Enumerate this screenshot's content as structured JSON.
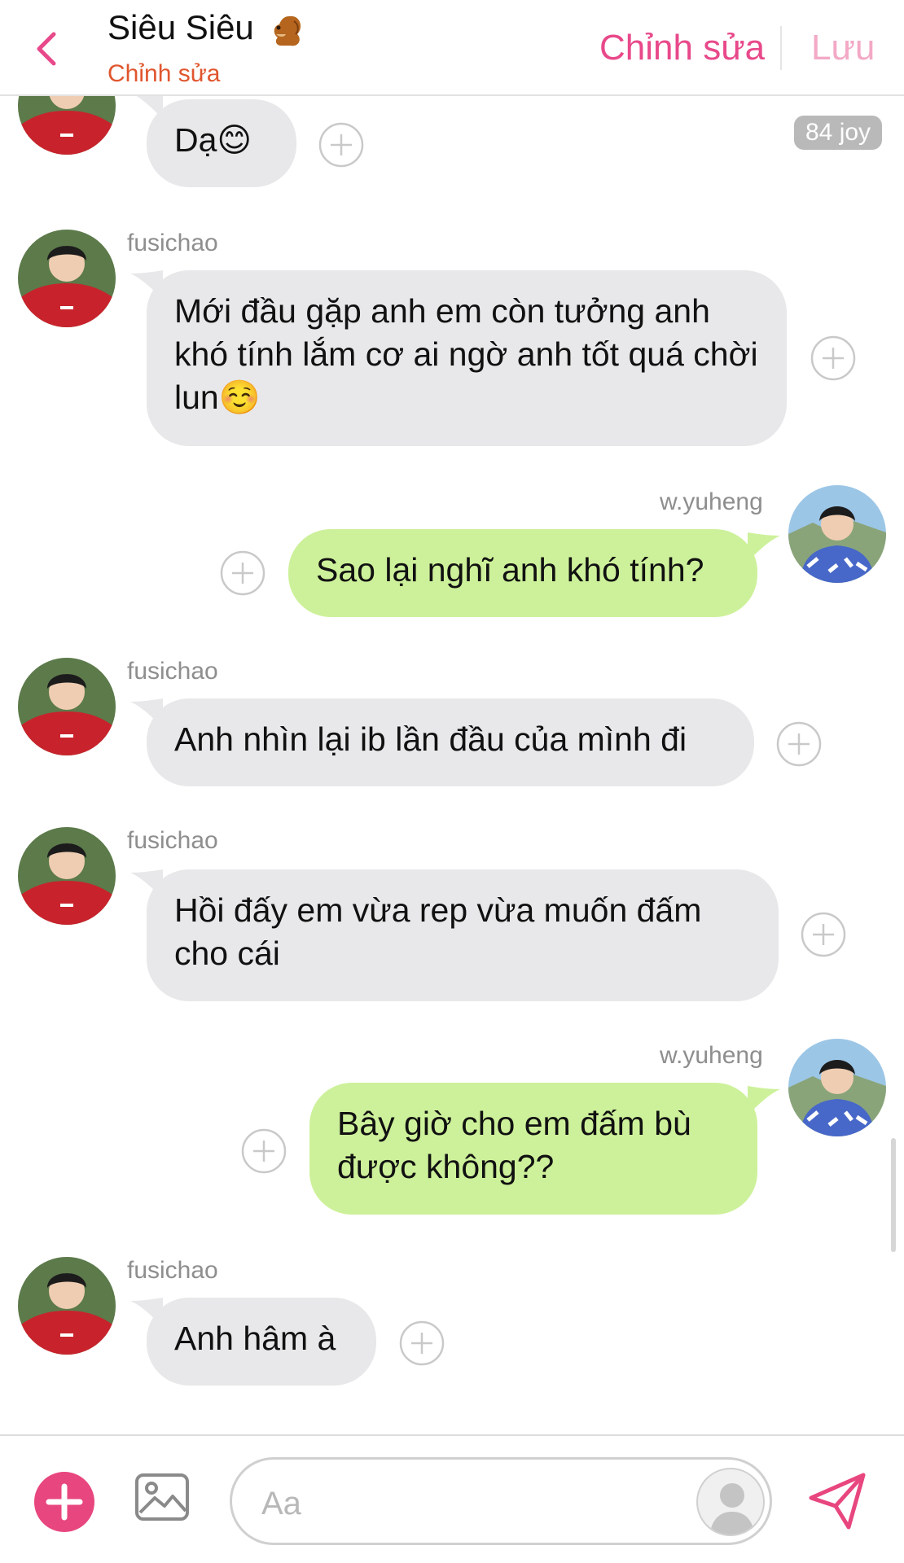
{
  "header": {
    "title": "Siêu Siêu",
    "subtitle": "Chỉnh sửa",
    "edit_label": "Chỉnh sửa",
    "save_label": "Lưu",
    "accent_color": "#e8498a"
  },
  "badge": {
    "joy": "84 joy"
  },
  "messages": [
    {
      "sender": "fusichao",
      "direction": "incoming",
      "text": "Dạ😊"
    },
    {
      "sender": "fusichao",
      "direction": "incoming",
      "text": "Mới đầu gặp anh em còn tưởng anh khó tính lắm cơ ai ngờ anh tốt quá chời lun☺️"
    },
    {
      "sender": "w.yuheng",
      "direction": "outgoing",
      "text": "Sao lại nghĩ anh khó tính?"
    },
    {
      "sender": "fusichao",
      "direction": "incoming",
      "text": "Anh nhìn lại ib lần đầu của mình đi"
    },
    {
      "sender": "fusichao",
      "direction": "incoming",
      "text": "Hồi đấy em vừa rep vừa muốn đấm cho cái"
    },
    {
      "sender": "w.yuheng",
      "direction": "outgoing",
      "text": "Bây giờ cho em đấm bù được không??"
    },
    {
      "sender": "fusichao",
      "direction": "incoming",
      "text": "Anh hâm à"
    }
  ],
  "composer": {
    "placeholder": "Aa"
  },
  "colors": {
    "incoming_bubble": "#e8e8ea",
    "outgoing_bubble": "#cdf19a",
    "add_button": "#e8467e",
    "subtitle": "#e0562e"
  }
}
